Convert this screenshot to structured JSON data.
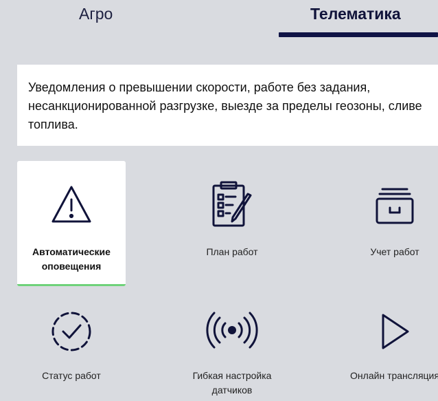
{
  "tabs": [
    {
      "label": "Агро",
      "active": false
    },
    {
      "label": "Телематика",
      "active": true
    }
  ],
  "description": "Уведомления о превышении скорости, работе без задания, несанкционированной разгрузке, выезде за пределы геозоны, сливе топлива.",
  "features": [
    {
      "label": "Автоматические оповещения",
      "icon": "warning-triangle-icon",
      "active": true
    },
    {
      "label": "План работ",
      "icon": "clipboard-checklist-icon",
      "active": false
    },
    {
      "label": "Учет работ",
      "icon": "file-drawer-icon",
      "active": false
    },
    {
      "label": "Статус работ",
      "icon": "dashed-circle-check-icon",
      "active": false
    },
    {
      "label": "Гибкая настройка датчиков",
      "icon": "broadcast-signal-icon",
      "active": false
    },
    {
      "label": "Онлайн трансляция",
      "icon": "play-icon",
      "active": false
    }
  ],
  "colors": {
    "background": "#d9dbe0",
    "accent": "#101446",
    "active_underline": "#6fd27a"
  }
}
